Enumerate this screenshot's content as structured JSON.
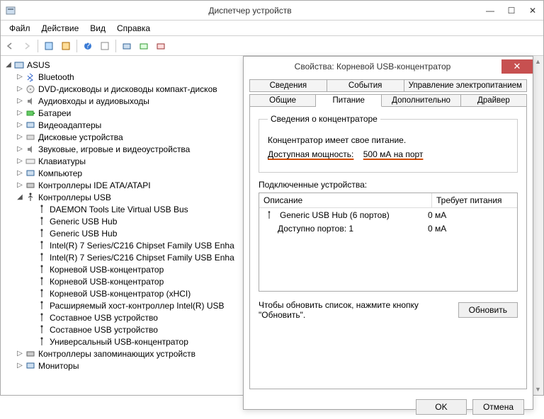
{
  "window": {
    "title": "Диспетчер устройств",
    "min": "—",
    "max": "☐",
    "close": "✕"
  },
  "menu": {
    "file": "Файл",
    "action": "Действие",
    "view": "Вид",
    "help": "Справка"
  },
  "tree": {
    "root": "ASUS",
    "bluetooth": "Bluetooth",
    "dvd": "DVD-дисководы и дисководы компакт-дисков",
    "audio": "Аудиовходы и аудиовыходы",
    "battery": "Батареи",
    "video": "Видеоадаптеры",
    "disk": "Дисковые устройства",
    "game": "Звуковые, игровые и видеоустройства",
    "keyboard": "Клавиатуры",
    "computer": "Компьютер",
    "ide": "Контроллеры IDE ATA/ATAPI",
    "usb": "Контроллеры USB",
    "usb_items": [
      "DAEMON Tools Lite Virtual USB Bus",
      "Generic USB Hub",
      "Generic USB Hub",
      "Intel(R) 7 Series/C216 Chipset Family USB Enha",
      "Intel(R) 7 Series/C216 Chipset Family USB Enha",
      "Корневой USB-концентратор",
      "Корневой USB-концентратор",
      "Корневой USB-концентратор (xHCI)",
      "Расширяемый хост-контроллер Intel(R) USB",
      "Составное USB устройство",
      "Составное USB устройство",
      "Универсальный USB-концентратор"
    ],
    "storage": "Контроллеры запоминающих устройств",
    "monitors": "Мониторы"
  },
  "dialog": {
    "title": "Свойства: Корневой USB-концентратор",
    "close": "✕",
    "tabs_row1": [
      "Сведения",
      "События",
      "Управление электропитанием"
    ],
    "tabs_row2": [
      "Общие",
      "Питание",
      "Дополнительно",
      "Драйвер"
    ],
    "hub_group": {
      "legend": "Сведения о концентраторе",
      "line1": "Концентратор имеет свое питание.",
      "line2a": "Доступная мощность:",
      "line2b": "500 мА на порт"
    },
    "devices": {
      "label": "Подключенные устройства:",
      "col1": "Описание",
      "col2": "Требует питания",
      "row1_desc": "Generic USB Hub (6 портов)",
      "row1_power": "0 мА",
      "row2_desc": "Доступно портов: 1",
      "row2_power": "0 мА"
    },
    "refresh": {
      "text": "Чтобы обновить список, нажмите кнопку \"Обновить\".",
      "btn": "Обновить"
    },
    "buttons": {
      "ok": "OK",
      "cancel": "Отмена"
    }
  }
}
